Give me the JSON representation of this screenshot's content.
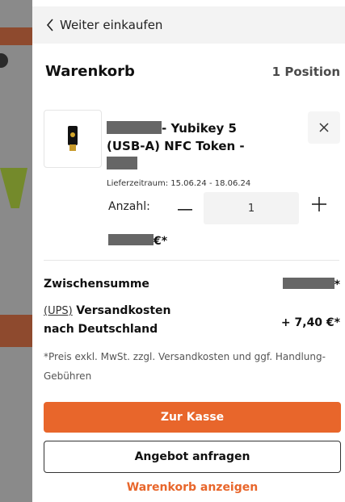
{
  "header": {
    "back_label": "Weiter einkaufen"
  },
  "cart": {
    "title": "Warenkorb",
    "position_count": "1 Position"
  },
  "item": {
    "name_line1": "- Yubikey 5",
    "name_line2": "(USB-A) NFC Token -",
    "delivery": "Lieferzeitraum: 15.06.24 - 18.06.24",
    "qty_label": "Anzahl:",
    "qty_value": "1",
    "price_suffix": "€*"
  },
  "summary": {
    "subtotal_label": "Zwischensumme",
    "subtotal_suffix": "*",
    "carrier": "(UPS)",
    "shipping_line1": "Versandkosten",
    "shipping_line2": "nach Deutschland",
    "shipping_value": "+ 7,40 €*",
    "disclaimer": "*Preis exkl. MwSt. zzgl. Versandkosten und ggf. Handlung-Gebühren"
  },
  "actions": {
    "checkout": "Zur Kasse",
    "quote": "Angebot anfragen",
    "view_cart": "Warenkorb anzeigen"
  },
  "colors": {
    "accent": "#e8662b"
  }
}
